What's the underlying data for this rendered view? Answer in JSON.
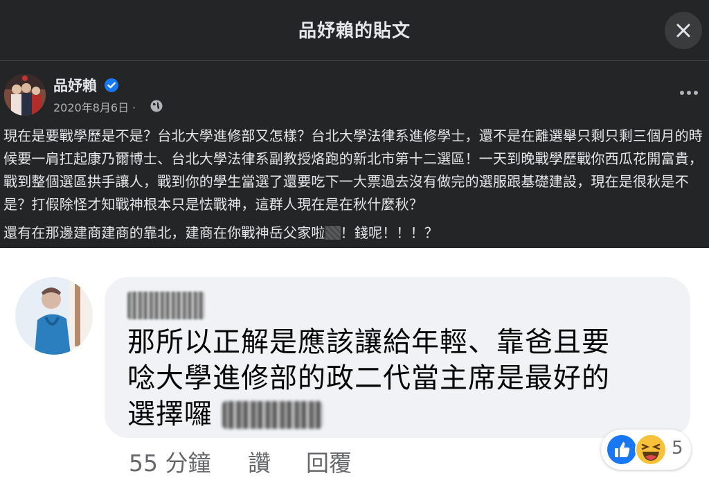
{
  "dialog": {
    "title": "品妤賴的貼文"
  },
  "post": {
    "author": "品妤賴",
    "date": "2020年8月6日 ·",
    "paragraph1": "現在是要戰學歷是不是？台北大學進修部又怎樣？台北大學法律系進修學士，還不是在離選舉只剩只剩三個月的時候要一肩扛起康乃爾博士、台北大學法律系副教授烙跑的新北市第十二選區！一天到晚戰學歷戰你西瓜花開富貴，戰到整個選區拱手讓人，戰到你的學生當選了還要吃下一大票過去沒有做完的選服跟基礎建設，現在是很秋是不是？打假除怪才知戰神根本只是怯戰神，這群人現在是在秋什麼秋？",
    "paragraph2_before": "還有在那邊建商建商的靠北，建商在你戰神岳父家啦",
    "paragraph2_after": "！錢呢！！！？"
  },
  "comment": {
    "text_line1": "那所以正解是應該讓給年輕、靠爸且要",
    "text_line2": "唸大學進修部的政二代當主席是最好的",
    "text_line3": "選擇囉",
    "time": "55 分鐘",
    "like_label": "讚",
    "reply_label": "回覆",
    "reaction_count": "5"
  },
  "colors": {
    "dark_panel": "#242526",
    "bubble": "#f0f2f5",
    "verified_blue": "#1877f2",
    "muted_text": "#65676b"
  },
  "icons": [
    "close-icon",
    "verified-badge-icon",
    "globe-icon",
    "more-options-icon",
    "like-reaction-icon",
    "haha-reaction-icon"
  ]
}
